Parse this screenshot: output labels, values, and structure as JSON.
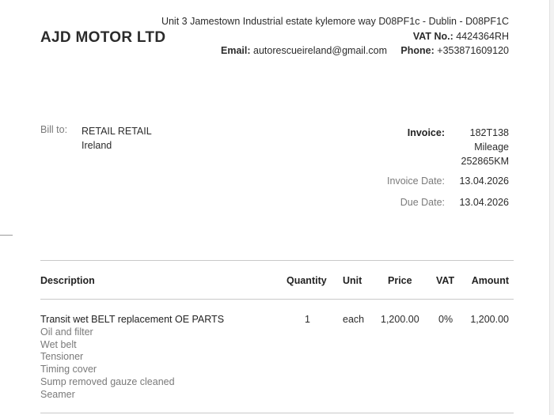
{
  "company": {
    "name": "AJD MOTOR LTD",
    "address": "Unit 3 Jamestown Industrial estate kylemore way D08PF1c - Dublin - D08PF1C",
    "vat_label": "VAT No.:",
    "vat_value": "4424364RH",
    "email_label": "Email:",
    "email_value": "autorescueireland@gmail.com",
    "phone_label": "Phone:",
    "phone_value": "+353871609120"
  },
  "bill_to": {
    "label": "Bill to:",
    "name": "RETAIL RETAIL",
    "country": "Ireland"
  },
  "invoice_meta": {
    "invoice_label": "Invoice:",
    "invoice_number": "182T138",
    "mileage_label": "Mileage",
    "mileage_value": "252865KM",
    "invoice_date_label": "Invoice Date:",
    "invoice_date": "13.04.2026",
    "due_date_label": "Due Date:",
    "due_date": "13.04.2026"
  },
  "table": {
    "headers": {
      "description": "Description",
      "quantity": "Quantity",
      "unit": "Unit",
      "price": "Price",
      "vat": "VAT",
      "amount": "Amount"
    },
    "rows": [
      {
        "description_lines": [
          "Transit wet BELT replacement OE PARTS",
          "Oil and filter",
          "Wet belt",
          "Tensioner",
          "Timing cover",
          "Sump removed gauze cleaned",
          "Seamer"
        ],
        "quantity": "1",
        "unit": "each",
        "price": "1,200.00",
        "vat": "0%",
        "amount": "1,200.00"
      }
    ]
  }
}
